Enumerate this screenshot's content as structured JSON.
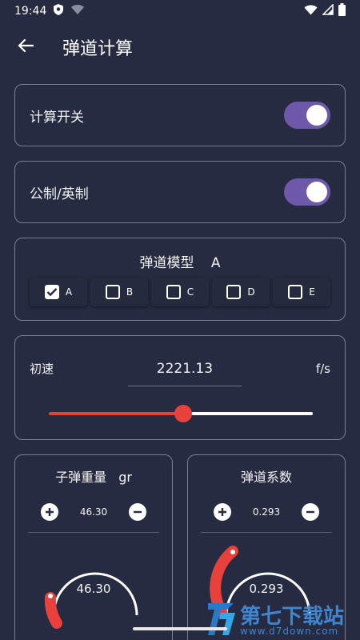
{
  "status_bar": {
    "time": "19:44"
  },
  "app_bar": {
    "title": "弹道计算"
  },
  "calc_switch": {
    "label": "计算开关",
    "on": true
  },
  "unit_switch": {
    "label": "公制/英制",
    "on": true
  },
  "ballistic_model": {
    "label": "弹道模型",
    "value": "A",
    "options": [
      {
        "label": "A",
        "checked": true
      },
      {
        "label": "B",
        "checked": false
      },
      {
        "label": "C",
        "checked": false
      },
      {
        "label": "D",
        "checked": false
      },
      {
        "label": "E",
        "checked": false
      }
    ]
  },
  "velocity": {
    "label": "初速",
    "value": "2221.13",
    "unit": "f/s",
    "slider_fraction": 0.51
  },
  "bullet_weight": {
    "label": "子弹重量",
    "unit": "gr",
    "value": "46.30",
    "gauge_value": "46.30"
  },
  "ballistic_coef": {
    "label": "弹道系数",
    "value": "0.293",
    "gauge_value": "0.293"
  },
  "watermark": {
    "brand": "第七下载站",
    "url": "www.d7down.com"
  },
  "colors": {
    "background": "#272b41",
    "accent": "#e8413c",
    "toggle": "#6e58a9"
  }
}
